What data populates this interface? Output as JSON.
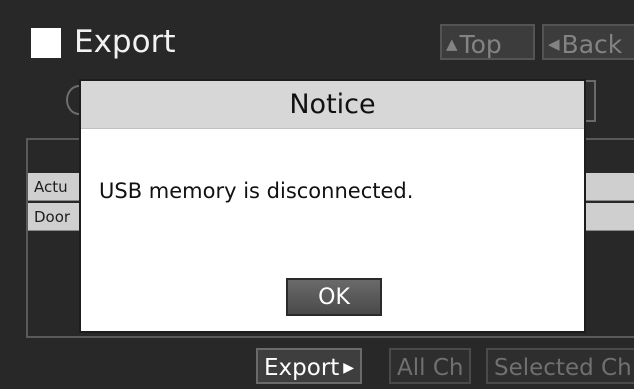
{
  "header": {
    "title": "Export",
    "top_button": "Top",
    "back_button": "Back"
  },
  "background": {
    "rows": [
      "Actu",
      "Door"
    ]
  },
  "toolbar": {
    "export_button": "Export",
    "all_ch_button": "All Ch",
    "selected_ch_button": "Selected Ch"
  },
  "dialog": {
    "title": "Notice",
    "message": "USB memory is disconnected.",
    "ok_button": "OK"
  },
  "icons": [
    "square-icon",
    "arrow-up-icon",
    "arrow-left-icon",
    "arrow-right-icon"
  ]
}
